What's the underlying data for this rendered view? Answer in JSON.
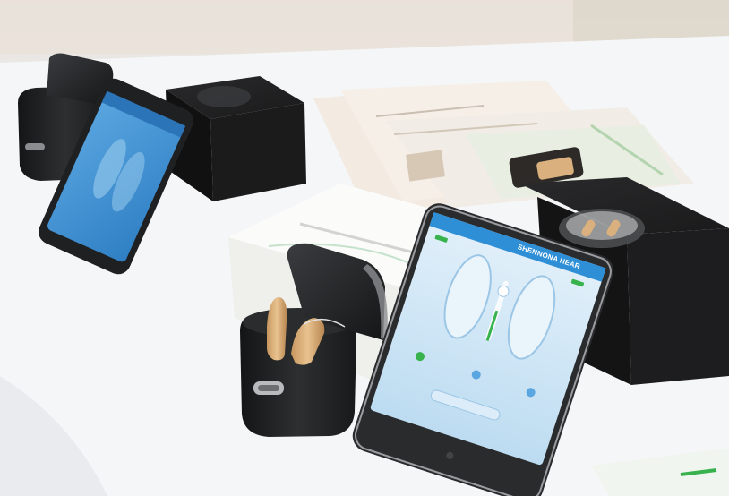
{
  "photo": {
    "description_icons": [
      "hearing-aid-icon",
      "charging-case-icon",
      "smartphone-icon"
    ],
    "colors": {
      "table": "#f4f5f7",
      "box_black": "#1c1c1e",
      "box_white": "#f7f7f5",
      "case_black": "#222426",
      "hearing_aid_beige": "#d9b07e",
      "app_header": "#2f8fd6",
      "app_background": "#cfe6f6",
      "phone_frame": "#2a2b2d"
    }
  },
  "phone": {
    "app_title": "SHENNONA HEAR"
  }
}
